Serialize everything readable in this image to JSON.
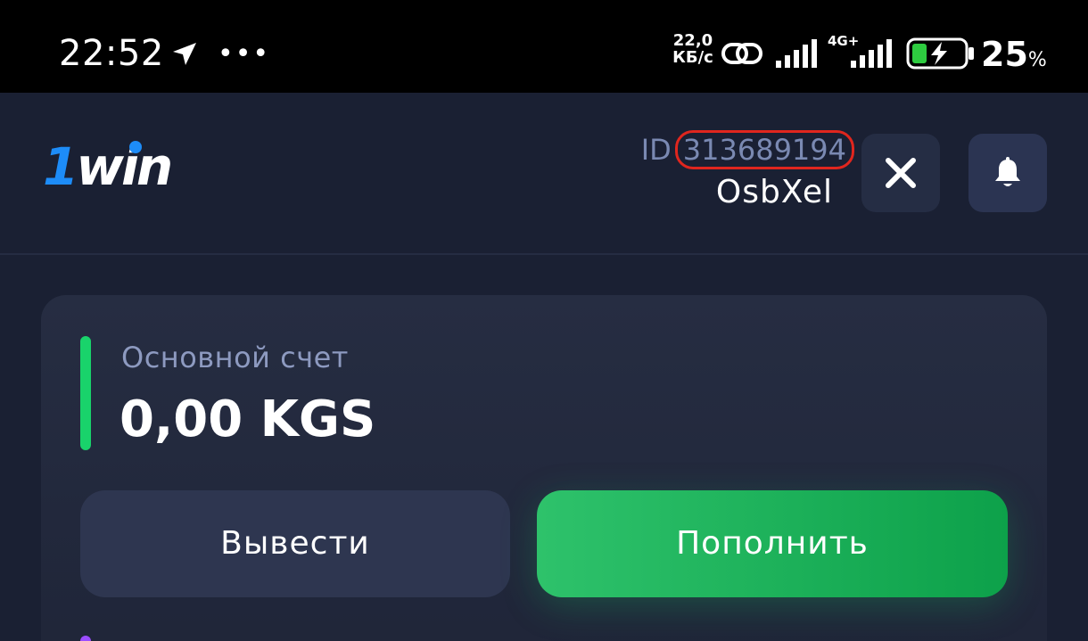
{
  "status_bar": {
    "time": "22:52",
    "more": "•••",
    "net_speed_value": "22,0",
    "net_speed_unit": "КБ/с",
    "network_type": "4G+",
    "battery_percent": "25",
    "battery_unit": "%",
    "icons": [
      "navigation-arrow-icon",
      "link-icon",
      "signal-icon",
      "signal-4g-icon",
      "battery-charging-icon"
    ]
  },
  "header": {
    "logo_prefix": "1",
    "logo_text": "win",
    "id_label": "ID",
    "id_value": "313689194",
    "username": "OsbXel",
    "icons": [
      "close-icon",
      "bell-icon"
    ]
  },
  "balance": {
    "label": "Основной счет",
    "amount": "0,00 KGS",
    "withdraw_label": "Вывести",
    "deposit_label": "Пополнить"
  },
  "colors": {
    "background": "#1a2033",
    "accent_green": "#19d36b",
    "brand_blue": "#1d8cf8",
    "highlight_red": "#e0261e"
  }
}
